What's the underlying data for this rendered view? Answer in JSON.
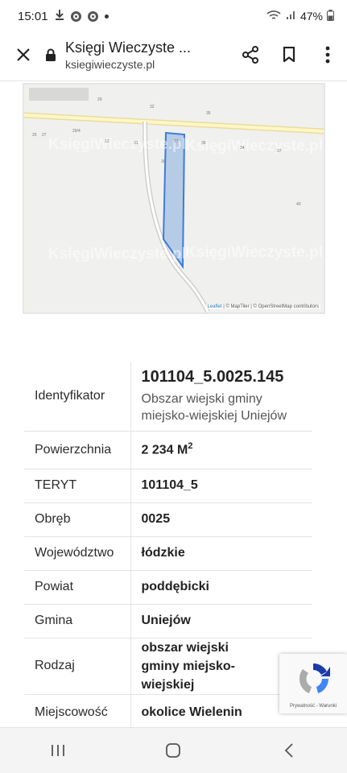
{
  "status_bar": {
    "time": "15:01",
    "battery": "47%"
  },
  "toolbar": {
    "page_title": "Księgi Wieczyste ...",
    "host": "ksiegiwieczyste.pl"
  },
  "map": {
    "watermarks": [
      "KsięgiWieczyste.pl",
      "KsięgiWieczyste.pl",
      "KsięgiWieczyste.pl",
      "KsięgiWieczyste.pl"
    ],
    "parcel_numbers": [
      "29",
      "32",
      "35",
      "26",
      "27",
      "29/4",
      "12",
      "31",
      "33",
      "36",
      "34",
      "37",
      "30",
      "40"
    ],
    "attribution_leaflet": "Leaflet",
    "attribution_rest": " | © MapTiler | © OpenStreetMap contributors",
    "parcel_color": "#3b7dd8"
  },
  "details": {
    "identifier_label": "Identyfikator",
    "identifier_value": "101104_5.0025.145",
    "identifier_sub": "Obszar wiejski gminy miejsko-wiejskiej Uniejów",
    "area_label": "Powierzchnia",
    "area_value": "2 234 M",
    "area_unit_sup": "2",
    "teryt_label": "TERYT",
    "teryt_value": "101104_5",
    "obreb_label": "Obręb",
    "obreb_value": "0025",
    "voivodeship_label": "Województwo",
    "voivodeship_value": "łódzkie",
    "county_label": "Powiat",
    "county_value": "poddębicki",
    "commune_label": "Gmina",
    "commune_value": "Uniejów",
    "type_label": "Rodzaj",
    "type_value": "obszar wiejski gminy miejsko-wiejskiej",
    "locality_label": "Miejscowość",
    "locality_value": "okolice Wielenin"
  },
  "recaptcha": {
    "links": "Prywatność - Warunki"
  }
}
